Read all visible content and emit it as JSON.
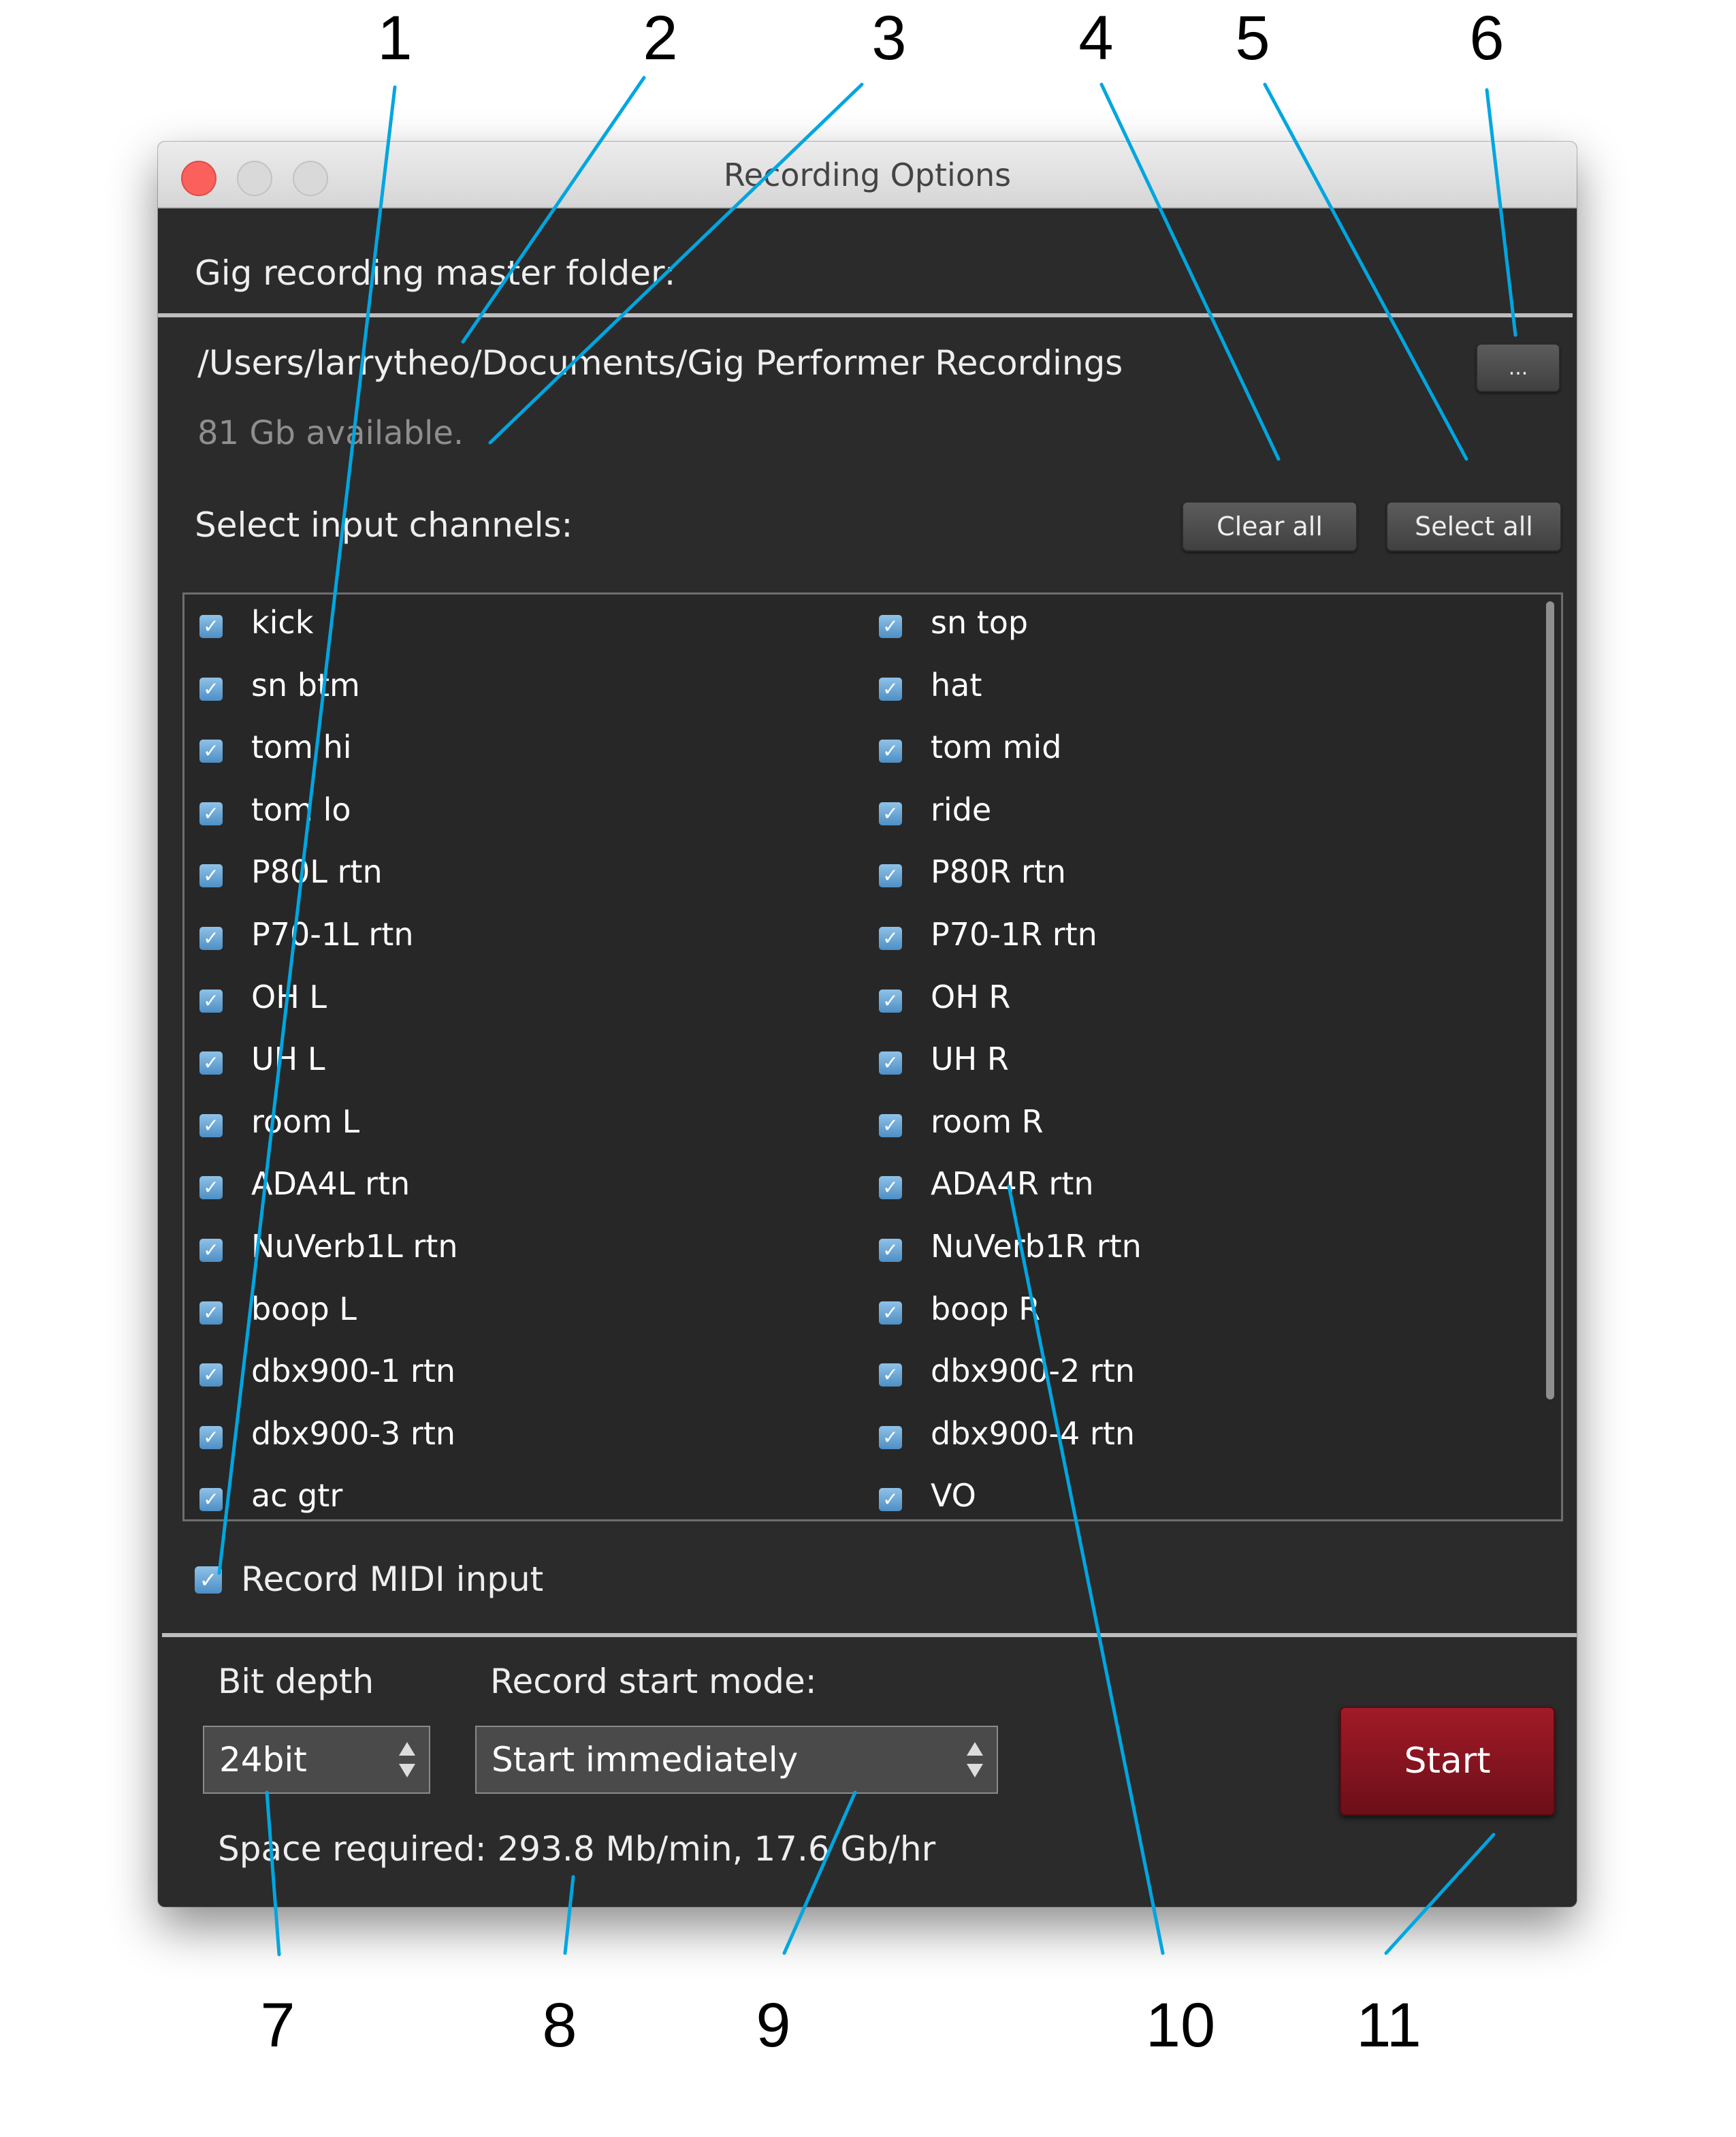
{
  "window": {
    "title": "Recording Options"
  },
  "folder": {
    "heading": "Gig recording master folder:",
    "path": "/Users/larrytheo/Documents/Gig Performer Recordings",
    "available": "81 Gb available.",
    "browse_label": "..."
  },
  "channels": {
    "heading": "Select input channels:",
    "clear_all_label": "Clear all",
    "select_all_label": "Select all",
    "items": [
      {
        "label": "kick",
        "checked": true
      },
      {
        "label": "sn top",
        "checked": true
      },
      {
        "label": "sn btm",
        "checked": true
      },
      {
        "label": "hat",
        "checked": true
      },
      {
        "label": "tom hi",
        "checked": true
      },
      {
        "label": "tom mid",
        "checked": true
      },
      {
        "label": "tom lo",
        "checked": true
      },
      {
        "label": "ride",
        "checked": true
      },
      {
        "label": "P80L rtn",
        "checked": true
      },
      {
        "label": "P80R rtn",
        "checked": true
      },
      {
        "label": "P70-1L rtn",
        "checked": true
      },
      {
        "label": "P70-1R rtn",
        "checked": true
      },
      {
        "label": "OH L",
        "checked": true
      },
      {
        "label": "OH R",
        "checked": true
      },
      {
        "label": "UH L",
        "checked": true
      },
      {
        "label": "UH R",
        "checked": true
      },
      {
        "label": "room L",
        "checked": true
      },
      {
        "label": "room R",
        "checked": true
      },
      {
        "label": "ADA4L rtn",
        "checked": true
      },
      {
        "label": "ADA4R rtn",
        "checked": true
      },
      {
        "label": "NuVerb1L rtn",
        "checked": true
      },
      {
        "label": "NuVerb1R rtn",
        "checked": true
      },
      {
        "label": "boop L",
        "checked": true
      },
      {
        "label": "boop R",
        "checked": true
      },
      {
        "label": "dbx900-1 rtn",
        "checked": true
      },
      {
        "label": "dbx900-2 rtn",
        "checked": true
      },
      {
        "label": "dbx900-3 rtn",
        "checked": true
      },
      {
        "label": "dbx900-4 rtn",
        "checked": true
      },
      {
        "label": "ac gtr",
        "checked": true
      },
      {
        "label": "VO",
        "checked": true
      }
    ]
  },
  "midi": {
    "label": "Record MIDI input",
    "checked": true
  },
  "bit_depth": {
    "label": "Bit depth",
    "value": "24bit"
  },
  "start_mode": {
    "label": "Record start mode:",
    "value": "Start immediately"
  },
  "space_required": "Space required: 293.8 Mb/min, 17.6 Gb/hr",
  "start_button": "Start",
  "callouts": [
    "1",
    "2",
    "3",
    "4",
    "5",
    "6",
    "7",
    "8",
    "9",
    "10",
    "11"
  ],
  "colors": {
    "window_bg": "#2b2b2b",
    "start_button": "#8b1420",
    "checkbox": "#5b9bd5",
    "callout_line": "#00a6e0"
  }
}
